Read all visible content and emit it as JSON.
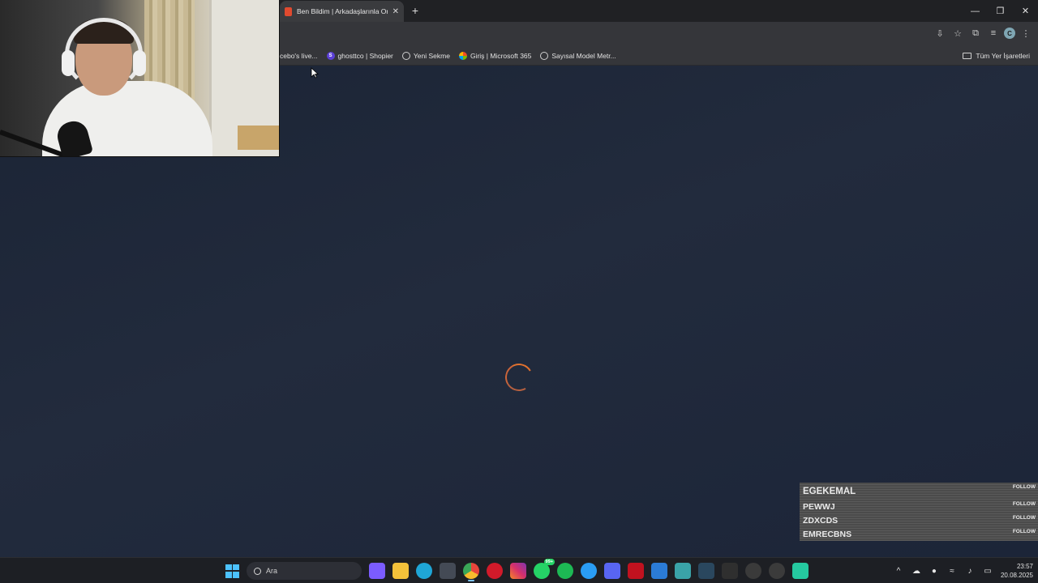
{
  "browser": {
    "tab_title": "Ben Bildim | Arkadaşlarınla Onl",
    "new_tab_symbol": "+",
    "close_symbol": "✕",
    "window_controls": [
      "—",
      "❐",
      "✕"
    ],
    "profile_initial": "C",
    "bookmarks": [
      {
        "label": "cebo's live...",
        "icon": "none"
      },
      {
        "label": "ghosttco | Shopier",
        "icon": "shopier-icon"
      },
      {
        "label": "Yeni Sekme",
        "icon": "globe-icon"
      },
      {
        "label": "Giriş | Microsoft 365",
        "icon": "microsoft-icon"
      },
      {
        "label": "Sayısal Model Metr...",
        "icon": "globe-icon"
      }
    ],
    "all_bookmarks_label": "Tüm Yer İşaretleri"
  },
  "page": {
    "state": "loading",
    "spinner_color": "#e0712e",
    "background": "#1c2536"
  },
  "follows": [
    {
      "name": "EGEKEMAL",
      "action": "FOLLOW"
    },
    {
      "name": "PEWWJ",
      "action": "FOLLOW"
    },
    {
      "name": "ZDXCDS",
      "action": "FOLLOW"
    },
    {
      "name": "EMRECBNS",
      "action": "FOLLOW"
    }
  ],
  "taskbar": {
    "search_placeholder": "Ara",
    "apps": [
      {
        "name": "copilot-icon",
        "color": "#7b5cff"
      },
      {
        "name": "file-explorer-icon",
        "color": "#f3c13a"
      },
      {
        "name": "edge-icon",
        "color": "#1fa6d6"
      },
      {
        "name": "store-icon",
        "color": "#444a55"
      },
      {
        "name": "chrome-icon",
        "color": "#e8453c"
      },
      {
        "name": "opera-icon",
        "color": "#d21a2a"
      },
      {
        "name": "instagram-icon",
        "color": "#d6306b"
      },
      {
        "name": "whatsapp-icon",
        "color": "#25d366"
      },
      {
        "name": "spotify-icon",
        "color": "#1db954"
      },
      {
        "name": "bip-icon",
        "color": "#2a9df4"
      },
      {
        "name": "discord-icon",
        "color": "#5865f2"
      },
      {
        "name": "netflix-icon",
        "color": "#c1121f"
      },
      {
        "name": "photos-icon",
        "color": "#2b7bd6"
      },
      {
        "name": "gallery-icon",
        "color": "#3aa3a8"
      },
      {
        "name": "steam-icon",
        "color": "#2a475e"
      },
      {
        "name": "epic-games-icon",
        "color": "#2f2f2f"
      },
      {
        "name": "steelseries-icon",
        "color": "#3a3a3a"
      },
      {
        "name": "obs-icon",
        "color": "#3b3b3b"
      },
      {
        "name": "bluestacks-icon",
        "color": "#25c9a0"
      }
    ],
    "whatsapp_badge": "99+",
    "time": "23:57",
    "date": "20.08.2025"
  }
}
